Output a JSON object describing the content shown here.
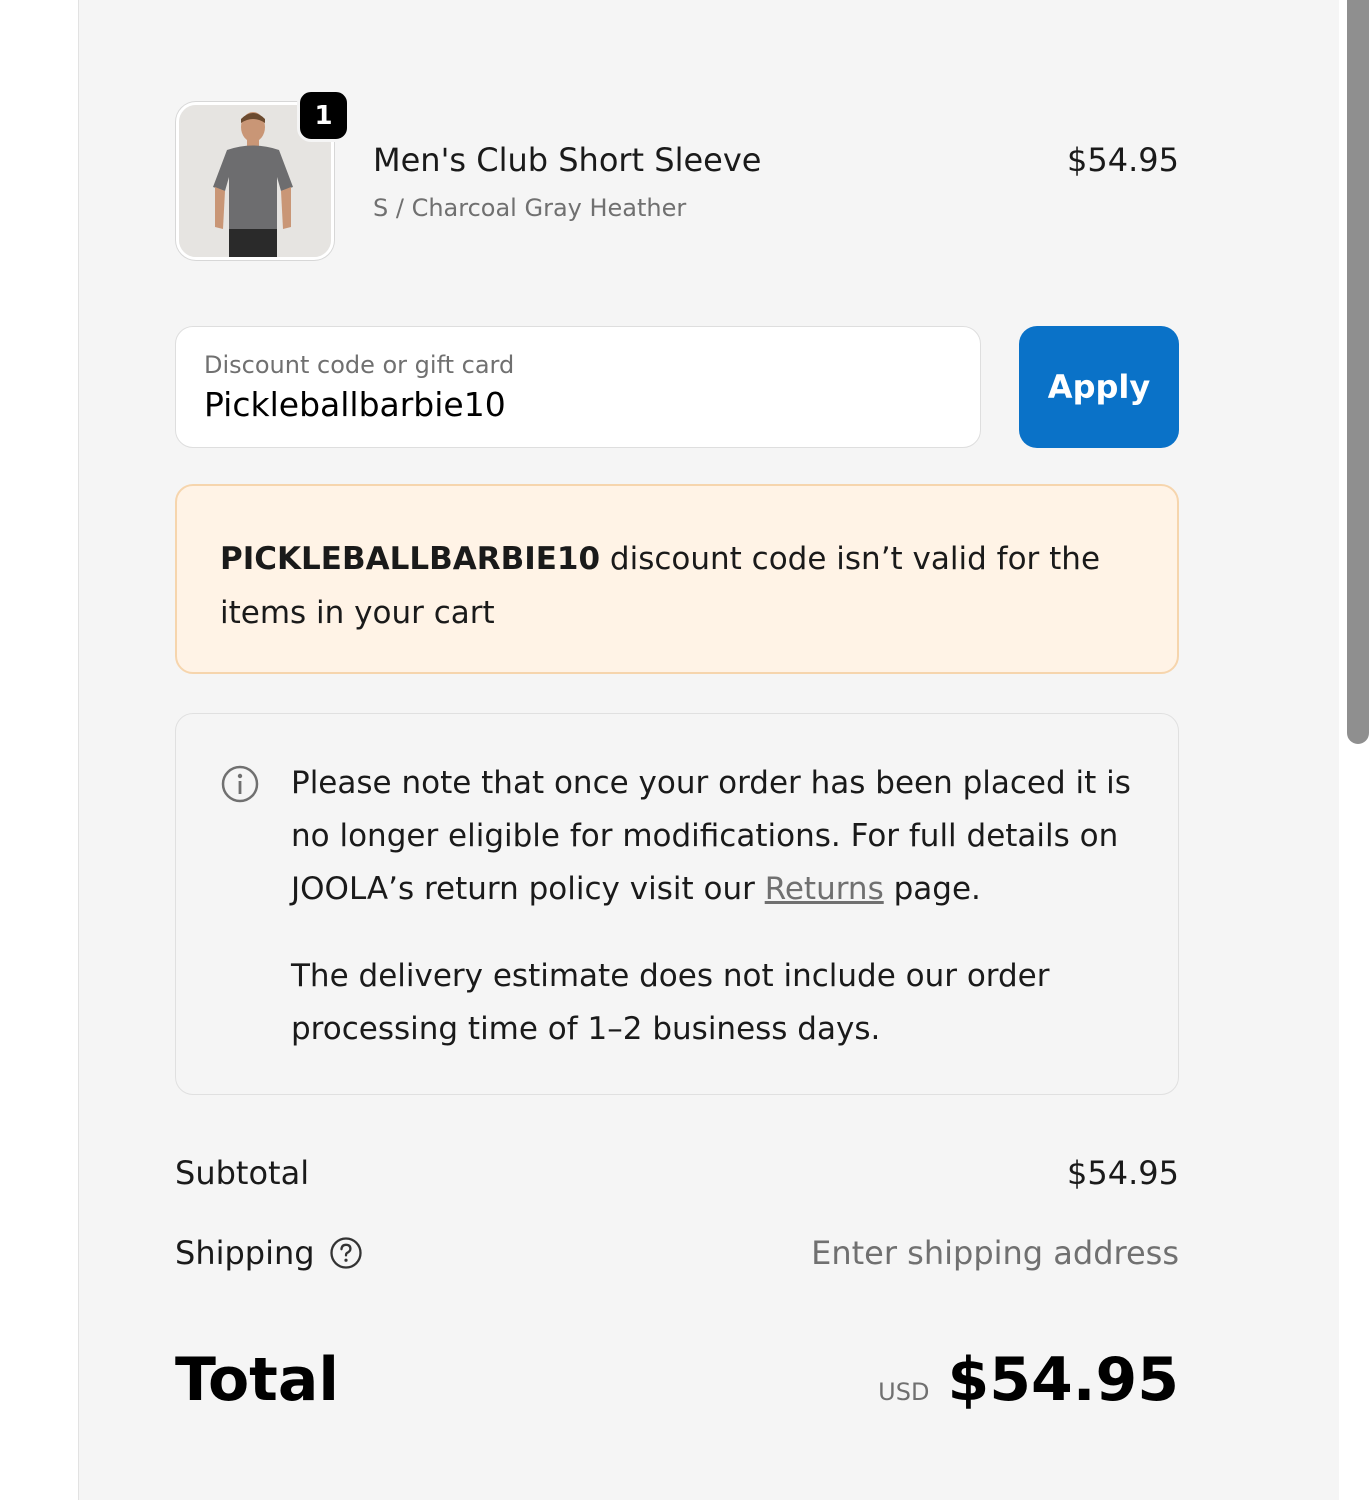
{
  "cart": {
    "item": {
      "quantity": "1",
      "name": "Men's Club Short Sleeve",
      "variant": "S / Charcoal Gray Heather",
      "price": "$54.95",
      "image_icon": "gray-tshirt-model-photo"
    }
  },
  "discount": {
    "label": "Discount code or gift card",
    "value": "Pickleballbarbie10",
    "apply_label": "Apply",
    "apply_color": "#0a72c8"
  },
  "error": {
    "code": "PICKLEBALLBARBIE10",
    "message": " discount code isn’t valid for the items in your cart",
    "background": "#fff3e6"
  },
  "notice": {
    "icon": "info-icon",
    "para1_before_link": "Please note that once your order has been placed it is no longer eligible for modifications. For full details on JOOLA’s return policy visit our ",
    "link_text": "Returns",
    "para1_after_link": " page.",
    "para2": "The delivery estimate does not include our order processing time of 1–2 business days."
  },
  "summary": {
    "subtotal_label": "Subtotal",
    "subtotal_value": "$54.95",
    "shipping_label": "Shipping",
    "shipping_icon": "question-circle-icon",
    "shipping_value": "Enter shipping address",
    "total_label": "Total",
    "currency": "USD",
    "total_value": "$54.95"
  }
}
